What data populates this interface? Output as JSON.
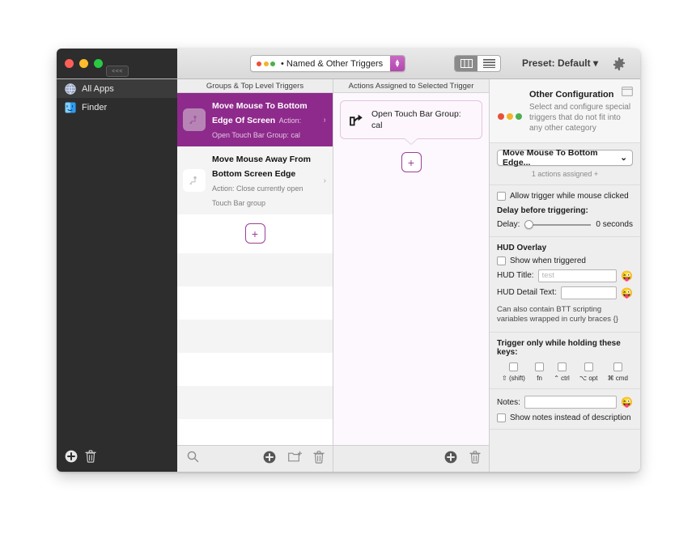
{
  "window": {
    "traffic_lights": [
      "close",
      "minimize",
      "zoom"
    ],
    "collapse_button_label": "<<<"
  },
  "toolbar": {
    "preset_popup": {
      "label": "• Named & Other Triggers",
      "dot_colors": [
        "#e8503a",
        "#f0b429",
        "#4caf50"
      ]
    },
    "view_segments": [
      {
        "name": "columns-view",
        "selected": true
      },
      {
        "name": "list-view",
        "selected": false
      }
    ],
    "preset_label": "Preset: Default ▾",
    "gear_label": "gear-icon"
  },
  "sidebar": {
    "items": [
      {
        "label": "All Apps",
        "icon": "all-apps-icon",
        "selected": true
      },
      {
        "label": "Finder",
        "icon": "finder-icon",
        "selected": false
      }
    ],
    "footer": {
      "add_label": "+",
      "delete_label": "trash-icon"
    }
  },
  "groups_column": {
    "header": "Groups & Top Level Triggers",
    "triggers": [
      {
        "title": "Move Mouse To Bottom Edge Of Screen",
        "subtitle": "Action: Open Touch Bar Group: cal",
        "selected": true,
        "chevron": "›"
      },
      {
        "title": "Move Mouse Away From Bottom Screen Edge",
        "subtitle": "Action: Close currently open Touch Bar group",
        "selected": false,
        "chevron": "›"
      }
    ],
    "add_button_label": "+",
    "footer": {
      "search_label": "search-icon",
      "add_label": "+",
      "new_folder_label": "new-folder-icon",
      "delete_label": "trash-icon"
    }
  },
  "actions_column": {
    "header": "Actions Assigned to Selected Trigger",
    "actions": [
      {
        "title": "Open Touch Bar Group:",
        "detail": "cal",
        "icon": "share-arrow-icon"
      }
    ],
    "add_button_label": "+",
    "footer": {
      "add_label": "+",
      "delete_label": "trash-icon"
    }
  },
  "panel": {
    "hero": {
      "title": "Other Configuration",
      "description": "Select and configure special triggers that do not fit into any other category",
      "dot_colors": [
        "#e8503a",
        "#f0b429",
        "#4caf50"
      ],
      "window_icon": "window-icon"
    },
    "trigger_select": {
      "value": "Move Mouse To Bottom Edge...",
      "chevron": "⌄"
    },
    "assigned_text": "1 actions assigned +",
    "allow_click": {
      "label": "Allow trigger while mouse clicked",
      "checked": false
    },
    "delay_section": {
      "title": "Delay before triggering:",
      "label": "Delay:",
      "value_text": "0 seconds",
      "slider_percent": 0
    },
    "hud": {
      "title": "HUD Overlay",
      "show_when_triggered": {
        "label": "Show when triggered",
        "checked": false
      },
      "title_field": {
        "label": "HUD Title:",
        "value": "",
        "placeholder": "test"
      },
      "detail_field": {
        "label": "HUD Detail Text:",
        "value": "",
        "placeholder": ""
      },
      "emoji_button": "😜",
      "note": "Can also contain BTT scripting variables wrapped in curly braces {}"
    },
    "modifiers": {
      "title": "Trigger only while holding these keys:",
      "keys": [
        {
          "label": "⇧ (shift)",
          "checked": false
        },
        {
          "label": "fn",
          "checked": false
        },
        {
          "label": "⌃ ctrl",
          "checked": false
        },
        {
          "label": "⌥ opt",
          "checked": false
        },
        {
          "label": "⌘ cmd",
          "checked": false
        }
      ]
    },
    "notes": {
      "label": "Notes:",
      "value": "",
      "emoji_button": "😜",
      "show_instead": {
        "label": "Show notes instead of description",
        "checked": false
      }
    }
  },
  "colors": {
    "accent_purple": "#8e2a8c",
    "plus_purple": "#9b3f97",
    "sidebar_dark": "#2d2d2d"
  }
}
